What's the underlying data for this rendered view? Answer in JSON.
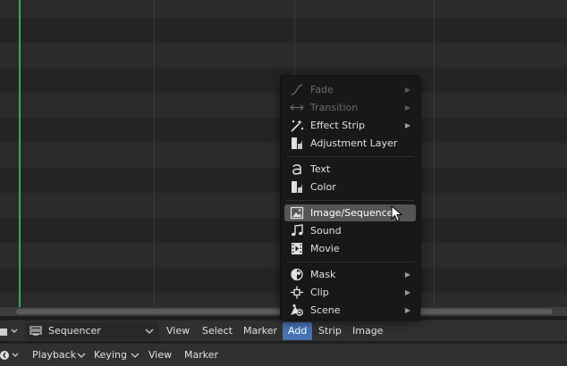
{
  "header": {
    "editor_mode": "Sequencer",
    "menus": [
      "View",
      "Select",
      "Marker",
      "Add",
      "Strip",
      "Image"
    ],
    "active_menu": "Add"
  },
  "footer": {
    "items": [
      "Playback",
      "Keying",
      "View",
      "Marker"
    ]
  },
  "add_menu": {
    "items": [
      {
        "label": "Fade",
        "icon": "fade-curve-icon",
        "submenu": true,
        "enabled": false
      },
      {
        "label": "Transition",
        "icon": "transition-arrows-icon",
        "submenu": true,
        "enabled": false
      },
      {
        "label": "Effect Strip",
        "icon": "effect-sparkle-icon",
        "submenu": true,
        "enabled": true
      },
      {
        "label": "Adjustment Layer",
        "icon": "adjustment-layer-icon",
        "submenu": false,
        "enabled": true
      },
      {
        "label": "Text",
        "icon": "text-icon",
        "submenu": false,
        "enabled": true
      },
      {
        "label": "Color",
        "icon": "color-icon",
        "submenu": false,
        "enabled": true
      },
      {
        "label": "Image/Sequence",
        "icon": "image-icon",
        "submenu": false,
        "enabled": true,
        "hovered": true
      },
      {
        "label": "Sound",
        "icon": "sound-note-icon",
        "submenu": false,
        "enabled": true
      },
      {
        "label": "Movie",
        "icon": "movie-film-icon",
        "submenu": false,
        "enabled": true
      },
      {
        "label": "Mask",
        "icon": "mask-icon",
        "submenu": true,
        "enabled": true
      },
      {
        "label": "Clip",
        "icon": "clip-tracker-icon",
        "submenu": true,
        "enabled": true
      },
      {
        "label": "Scene",
        "icon": "scene-icon",
        "submenu": true,
        "enabled": true
      }
    ]
  },
  "colors": {
    "playhead": "#2bb446",
    "menu_highlight": "#4772b3",
    "menu_hover": "#555555"
  }
}
